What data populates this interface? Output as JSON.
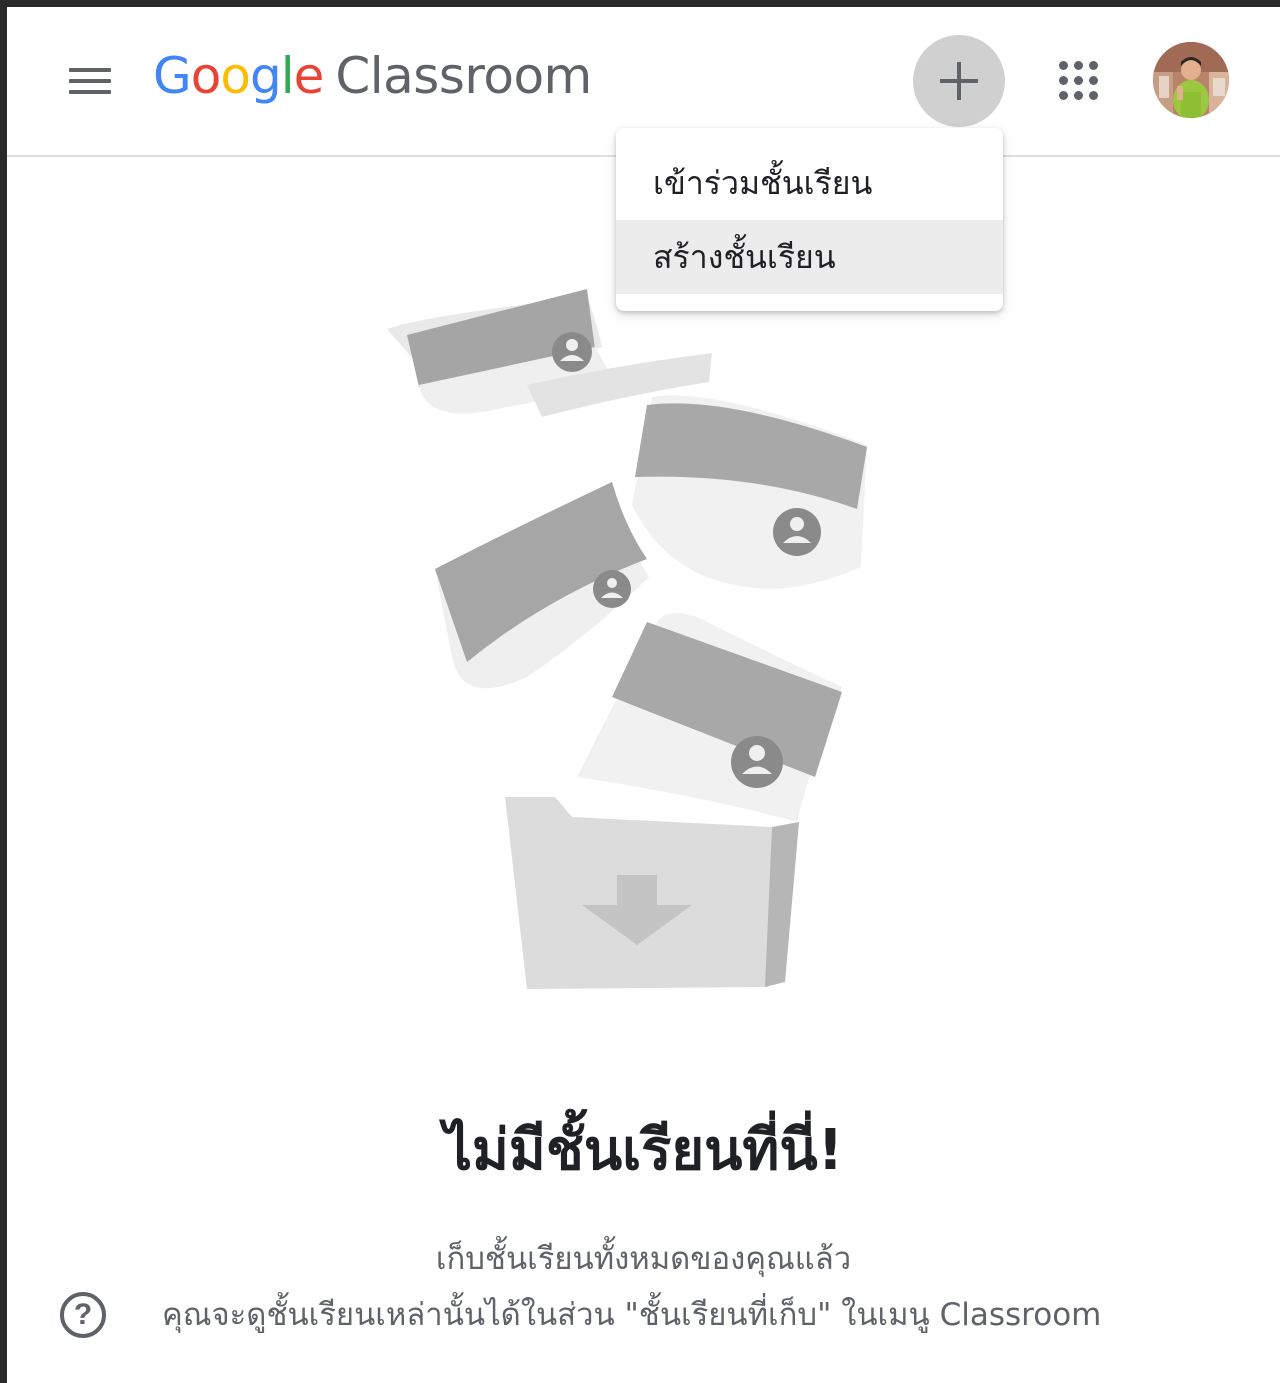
{
  "header": {
    "menu_icon": "hamburger-menu-icon",
    "logo": {
      "letters": [
        "G",
        "o",
        "o",
        "g",
        "l",
        "e"
      ],
      "product": "Classroom"
    },
    "add_icon": "plus-icon",
    "apps_icon": "apps-grid-icon",
    "avatar_icon": "user-avatar"
  },
  "dropdown": {
    "items": [
      {
        "label": "เข้าร่วมชั้นเรียน"
      },
      {
        "label": "สร้างชั้นเรียน"
      }
    ]
  },
  "empty_state": {
    "title": "ไม่มีชั้นเรียนที่นี่!",
    "line1": "เก็บชั้นเรียนทั้งหมดของคุณแล้ว",
    "line2": "คุณจะดูชั้นเรียนเหล่านั้นได้ในส่วน \"ชั้นเรียนที่เก็บ\" ในเมนู Classroom"
  },
  "help": {
    "symbol": "?",
    "icon": "help-circle-icon"
  },
  "colors": {
    "google_blue": "#4285f4",
    "google_red": "#ea4335",
    "google_yellow": "#fbbc05",
    "google_green": "#34a853",
    "text_secondary": "#5f6368",
    "highlight": "#ececec"
  }
}
